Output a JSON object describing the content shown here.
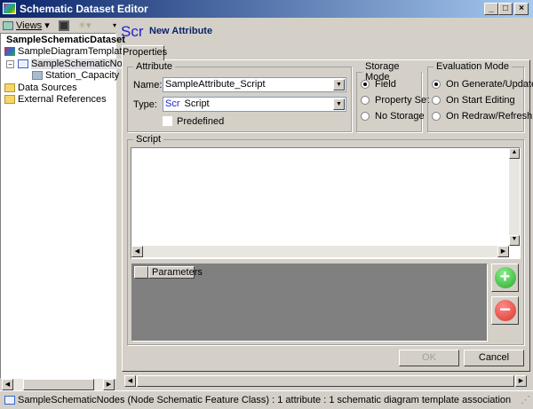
{
  "window": {
    "title": "Schematic Dataset Editor",
    "buttons": [
      "_",
      "□",
      "×"
    ]
  },
  "toolbar": {
    "views_label": "Views"
  },
  "tree": {
    "root": "SampleSchematicDataset",
    "items": [
      {
        "label": "SampleDiagramTemplate",
        "icon": "diagram-template-icon"
      },
      {
        "label": "SampleSchematicNodes",
        "icon": "node-class-icon",
        "expanded": true,
        "selected": true
      },
      {
        "label": "Station_Capacity",
        "icon": "table-icon"
      },
      {
        "label": "Data Sources",
        "icon": "folder-icon"
      },
      {
        "label": "External References",
        "icon": "folder-icon"
      }
    ]
  },
  "header": {
    "icon_text": "Scr",
    "title": "New Attribute"
  },
  "tabs": [
    "Properties"
  ],
  "attribute": {
    "legend": "Attribute",
    "name_label": "Name:",
    "name_value": "SampleAttribute_Script",
    "type_label": "Type:",
    "type_icon": "Scr",
    "type_value": "Script",
    "predefined_label": "Predefined",
    "predefined_checked": false
  },
  "storage": {
    "legend": "Storage Mode",
    "options": [
      "Field",
      "Property Set",
      "No Storage"
    ],
    "selected": "Field"
  },
  "evaluation": {
    "legend": "Evaluation Mode",
    "options": [
      "On Generate/Update",
      "On Start Editing",
      "On Redraw/Refresh"
    ],
    "selected": "On Generate/Update"
  },
  "script": {
    "legend": "Script",
    "content": "",
    "parameters_header": "Parameters"
  },
  "buttons": {
    "ok": "OK",
    "cancel": "Cancel",
    "ok_enabled": false
  },
  "status": {
    "text": "SampleSchematicNodes (Node Schematic Feature Class) : 1 attribute : 1 schematic diagram template association"
  },
  "colors": {
    "title_start": "#0a246a",
    "title_end": "#a6caf0",
    "header_text": "#0a246a",
    "add": "#2ea82e",
    "remove": "#d63a2a"
  }
}
